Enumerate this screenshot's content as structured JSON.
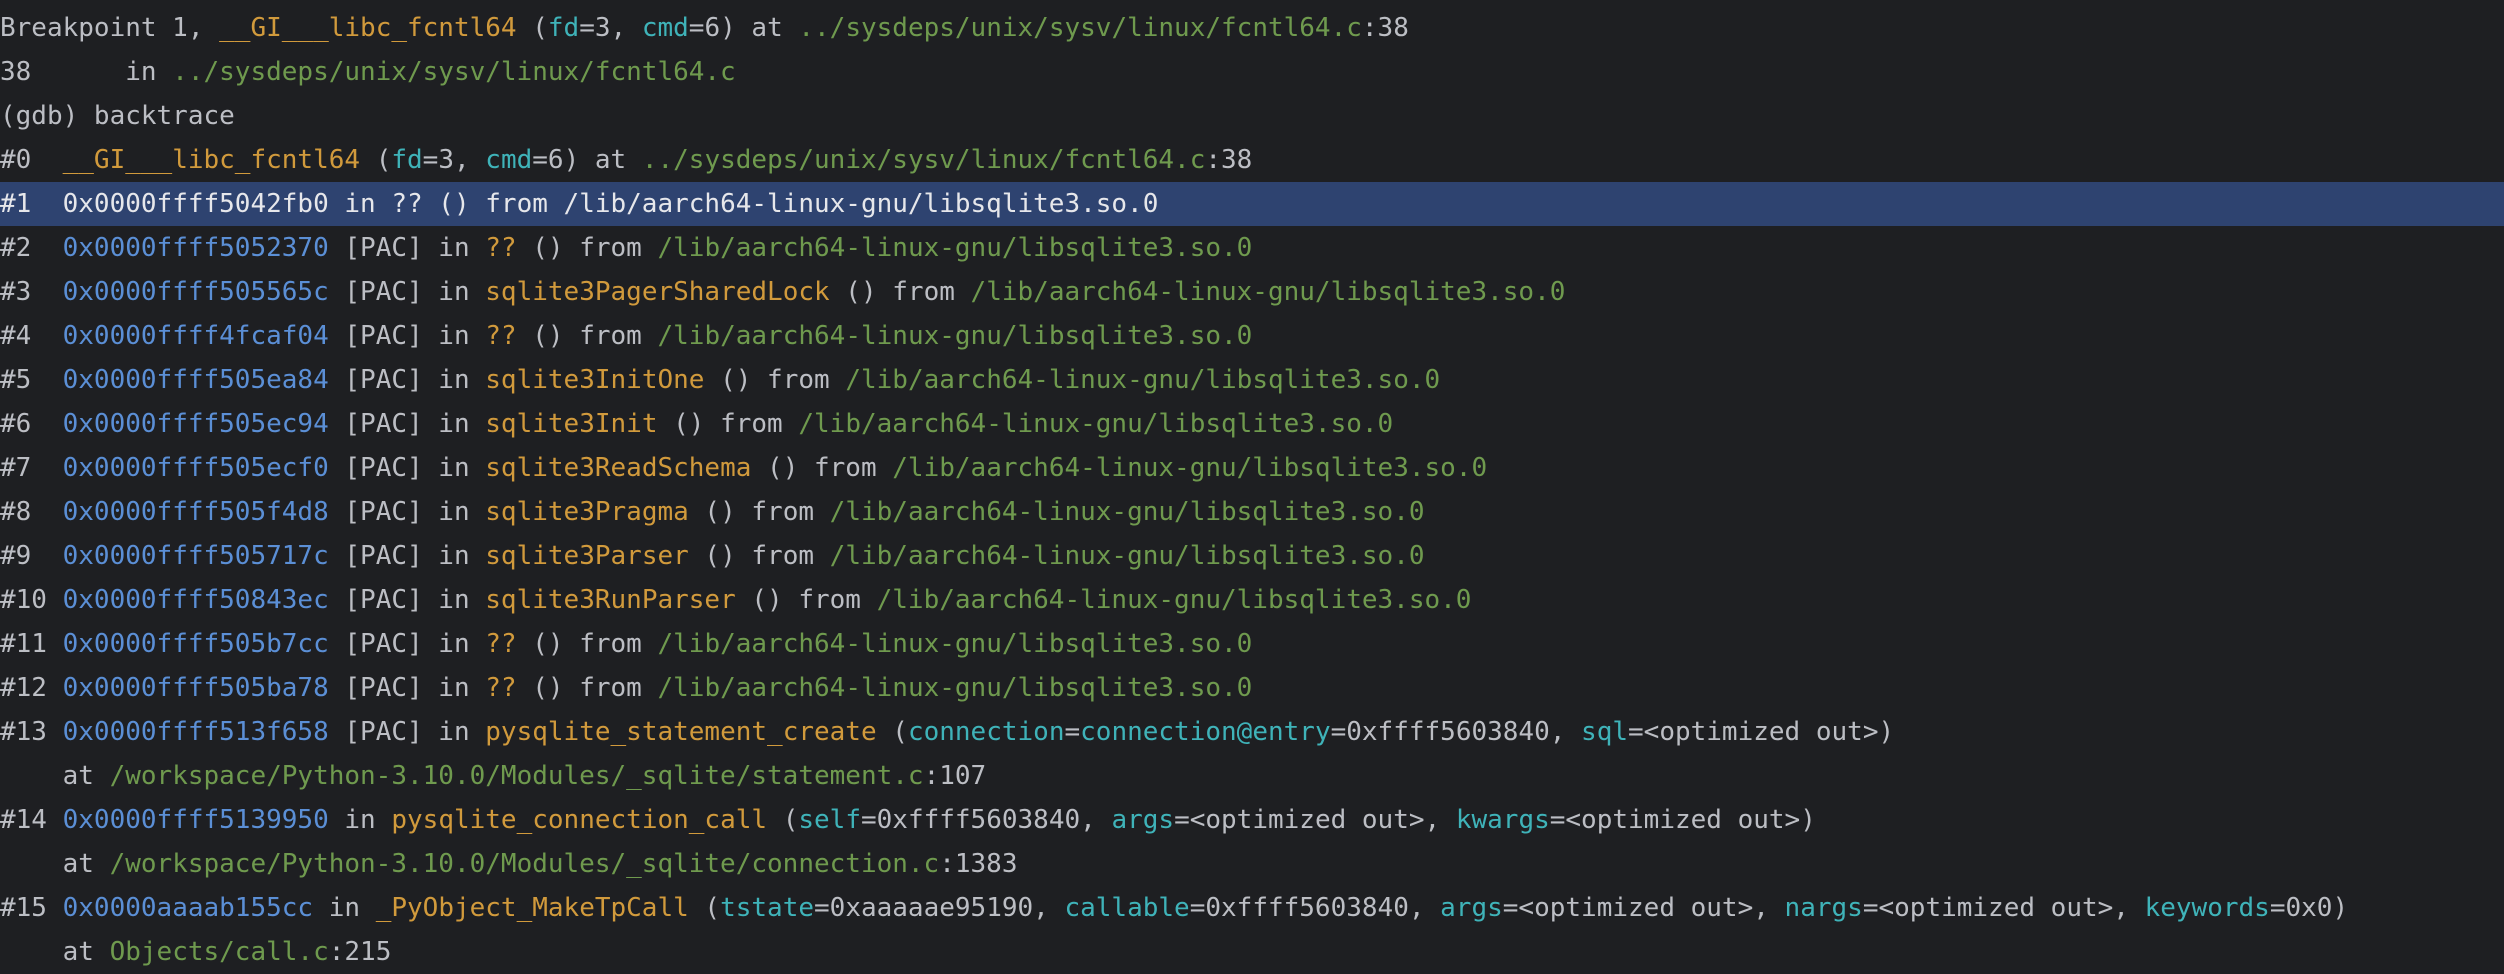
{
  "colors": {
    "background": "#1e1f22",
    "selection": "#2e4370",
    "text": "#bcbec4",
    "function": "#d19a3c",
    "path": "#6f9a4e",
    "address": "#5b8fd6",
    "parameter": "#3fb3b9"
  },
  "selected_line_index": 4,
  "lines": [
    [
      [
        "default",
        "Breakpoint 1, "
      ],
      [
        "func",
        "__GI___libc_fcntl64"
      ],
      [
        "default",
        " ("
      ],
      [
        "param",
        "fd"
      ],
      [
        "default",
        "=3, "
      ],
      [
        "param",
        "cmd"
      ],
      [
        "default",
        "=6) at "
      ],
      [
        "path",
        "../sysdeps/unix/sysv/linux/fcntl64.c"
      ],
      [
        "default",
        ":38"
      ]
    ],
    [
      [
        "default",
        "38      in "
      ],
      [
        "path",
        "../sysdeps/unix/sysv/linux/fcntl64.c"
      ]
    ],
    [
      [
        "default",
        "(gdb) backtrace"
      ]
    ],
    [
      [
        "default",
        "#0  "
      ],
      [
        "func",
        "__GI___libc_fcntl64"
      ],
      [
        "default",
        " ("
      ],
      [
        "param",
        "fd"
      ],
      [
        "default",
        "=3, "
      ],
      [
        "param",
        "cmd"
      ],
      [
        "default",
        "=6) at "
      ],
      [
        "path",
        "../sysdeps/unix/sysv/linux/fcntl64.c"
      ],
      [
        "default",
        ":38"
      ]
    ],
    [
      [
        "default",
        "#1  "
      ],
      [
        "addr",
        "0x0000ffff5042fb0"
      ],
      [
        "default",
        " in ?? () from /lib/aarch64-linux-gnu/libsqlite3.so.0"
      ]
    ],
    [
      [
        "default",
        "#2  "
      ],
      [
        "addr",
        "0x0000ffff5052370"
      ],
      [
        "default",
        " [PAC] in "
      ],
      [
        "func",
        "??"
      ],
      [
        "default",
        " () from "
      ],
      [
        "path",
        "/lib/aarch64-linux-gnu/libsqlite3.so.0"
      ]
    ],
    [
      [
        "default",
        "#3  "
      ],
      [
        "addr",
        "0x0000ffff505565c"
      ],
      [
        "default",
        " [PAC] in "
      ],
      [
        "func",
        "sqlite3PagerSharedLock"
      ],
      [
        "default",
        " () from "
      ],
      [
        "path",
        "/lib/aarch64-linux-gnu/libsqlite3.so.0"
      ]
    ],
    [
      [
        "default",
        "#4  "
      ],
      [
        "addr",
        "0x0000ffff4fcaf04"
      ],
      [
        "default",
        " [PAC] in "
      ],
      [
        "func",
        "??"
      ],
      [
        "default",
        " () from "
      ],
      [
        "path",
        "/lib/aarch64-linux-gnu/libsqlite3.so.0"
      ]
    ],
    [
      [
        "default",
        "#5  "
      ],
      [
        "addr",
        "0x0000ffff505ea84"
      ],
      [
        "default",
        " [PAC] in "
      ],
      [
        "func",
        "sqlite3InitOne"
      ],
      [
        "default",
        " () from "
      ],
      [
        "path",
        "/lib/aarch64-linux-gnu/libsqlite3.so.0"
      ]
    ],
    [
      [
        "default",
        "#6  "
      ],
      [
        "addr",
        "0x0000ffff505ec94"
      ],
      [
        "default",
        " [PAC] in "
      ],
      [
        "func",
        "sqlite3Init"
      ],
      [
        "default",
        " () from "
      ],
      [
        "path",
        "/lib/aarch64-linux-gnu/libsqlite3.so.0"
      ]
    ],
    [
      [
        "default",
        "#7  "
      ],
      [
        "addr",
        "0x0000ffff505ecf0"
      ],
      [
        "default",
        " [PAC] in "
      ],
      [
        "func",
        "sqlite3ReadSchema"
      ],
      [
        "default",
        " () from "
      ],
      [
        "path",
        "/lib/aarch64-linux-gnu/libsqlite3.so.0"
      ]
    ],
    [
      [
        "default",
        "#8  "
      ],
      [
        "addr",
        "0x0000ffff505f4d8"
      ],
      [
        "default",
        " [PAC] in "
      ],
      [
        "func",
        "sqlite3Pragma"
      ],
      [
        "default",
        " () from "
      ],
      [
        "path",
        "/lib/aarch64-linux-gnu/libsqlite3.so.0"
      ]
    ],
    [
      [
        "default",
        "#9  "
      ],
      [
        "addr",
        "0x0000ffff505717c"
      ],
      [
        "default",
        " [PAC] in "
      ],
      [
        "func",
        "sqlite3Parser"
      ],
      [
        "default",
        " () from "
      ],
      [
        "path",
        "/lib/aarch64-linux-gnu/libsqlite3.so.0"
      ]
    ],
    [
      [
        "default",
        "#10 "
      ],
      [
        "addr",
        "0x0000ffff50843ec"
      ],
      [
        "default",
        " [PAC] in "
      ],
      [
        "func",
        "sqlite3RunParser"
      ],
      [
        "default",
        " () from "
      ],
      [
        "path",
        "/lib/aarch64-linux-gnu/libsqlite3.so.0"
      ]
    ],
    [
      [
        "default",
        "#11 "
      ],
      [
        "addr",
        "0x0000ffff505b7cc"
      ],
      [
        "default",
        " [PAC] in "
      ],
      [
        "func",
        "??"
      ],
      [
        "default",
        " () from "
      ],
      [
        "path",
        "/lib/aarch64-linux-gnu/libsqlite3.so.0"
      ]
    ],
    [
      [
        "default",
        "#12 "
      ],
      [
        "addr",
        "0x0000ffff505ba78"
      ],
      [
        "default",
        " [PAC] in "
      ],
      [
        "func",
        "??"
      ],
      [
        "default",
        " () from "
      ],
      [
        "path",
        "/lib/aarch64-linux-gnu/libsqlite3.so.0"
      ]
    ],
    [
      [
        "default",
        "#13 "
      ],
      [
        "addr",
        "0x0000ffff513f658"
      ],
      [
        "default",
        " [PAC] in "
      ],
      [
        "func",
        "pysqlite_statement_create"
      ],
      [
        "default",
        " ("
      ],
      [
        "param",
        "connection"
      ],
      [
        "default",
        "="
      ],
      [
        "param",
        "connection@entry"
      ],
      [
        "default",
        "=0xffff5603840, "
      ],
      [
        "param",
        "sql"
      ],
      [
        "default",
        "=<optimized out>)"
      ]
    ],
    [
      [
        "default",
        "    at "
      ],
      [
        "path",
        "/workspace/Python-3.10.0/Modules/_sqlite/statement.c"
      ],
      [
        "default",
        ":107"
      ]
    ],
    [
      [
        "default",
        "#14 "
      ],
      [
        "addr",
        "0x0000ffff5139950"
      ],
      [
        "default",
        " in "
      ],
      [
        "func",
        "pysqlite_connection_call"
      ],
      [
        "default",
        " ("
      ],
      [
        "param",
        "self"
      ],
      [
        "default",
        "=0xffff5603840, "
      ],
      [
        "param",
        "args"
      ],
      [
        "default",
        "=<optimized out>, "
      ],
      [
        "param",
        "kwargs"
      ],
      [
        "default",
        "=<optimized out>)"
      ]
    ],
    [
      [
        "default",
        "    at "
      ],
      [
        "path",
        "/workspace/Python-3.10.0/Modules/_sqlite/connection.c"
      ],
      [
        "default",
        ":1383"
      ]
    ],
    [
      [
        "default",
        "#15 "
      ],
      [
        "addr",
        "0x0000aaaab155cc"
      ],
      [
        "default",
        " in "
      ],
      [
        "func",
        "_PyObject_MakeTpCall"
      ],
      [
        "default",
        " ("
      ],
      [
        "param",
        "tstate"
      ],
      [
        "default",
        "=0xaaaaae95190, "
      ],
      [
        "param",
        "callable"
      ],
      [
        "default",
        "=0xffff5603840, "
      ],
      [
        "param",
        "args"
      ],
      [
        "default",
        "=<optimized out>, "
      ],
      [
        "param",
        "nargs"
      ],
      [
        "default",
        "=<optimized out>, "
      ],
      [
        "param",
        "keywords"
      ],
      [
        "default",
        "=0x0)"
      ]
    ],
    [
      [
        "default",
        "    at "
      ],
      [
        "path",
        "Objects/call.c"
      ],
      [
        "default",
        ":215"
      ]
    ]
  ]
}
